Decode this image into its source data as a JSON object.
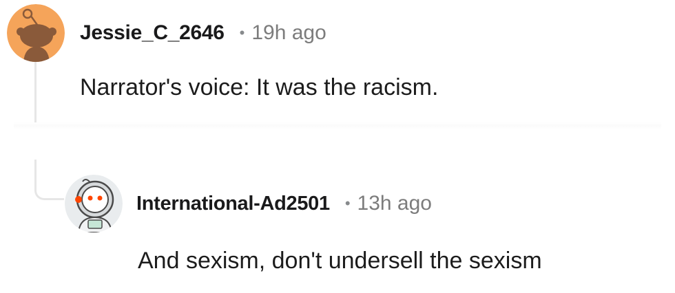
{
  "comments": [
    {
      "username": "Jessie_C_2646",
      "separator": "•",
      "timestamp": "19h ago",
      "body": "Narrator's voice: It was the racism.",
      "avatar_icon": "snoo-orange-avatar-icon"
    },
    {
      "username": "International-Ad2501",
      "separator": "•",
      "timestamp": "13h ago",
      "body": "And sexism, don't undersell the sexism",
      "avatar_icon": "snoo-astronaut-avatar-icon"
    }
  ],
  "colors": {
    "avatar_orange_bg": "#f5a45a",
    "avatar_orange_snoo": "#8a5a3a",
    "thread_line": "#e6e6e6",
    "meta_text": "#7c7c7c"
  }
}
